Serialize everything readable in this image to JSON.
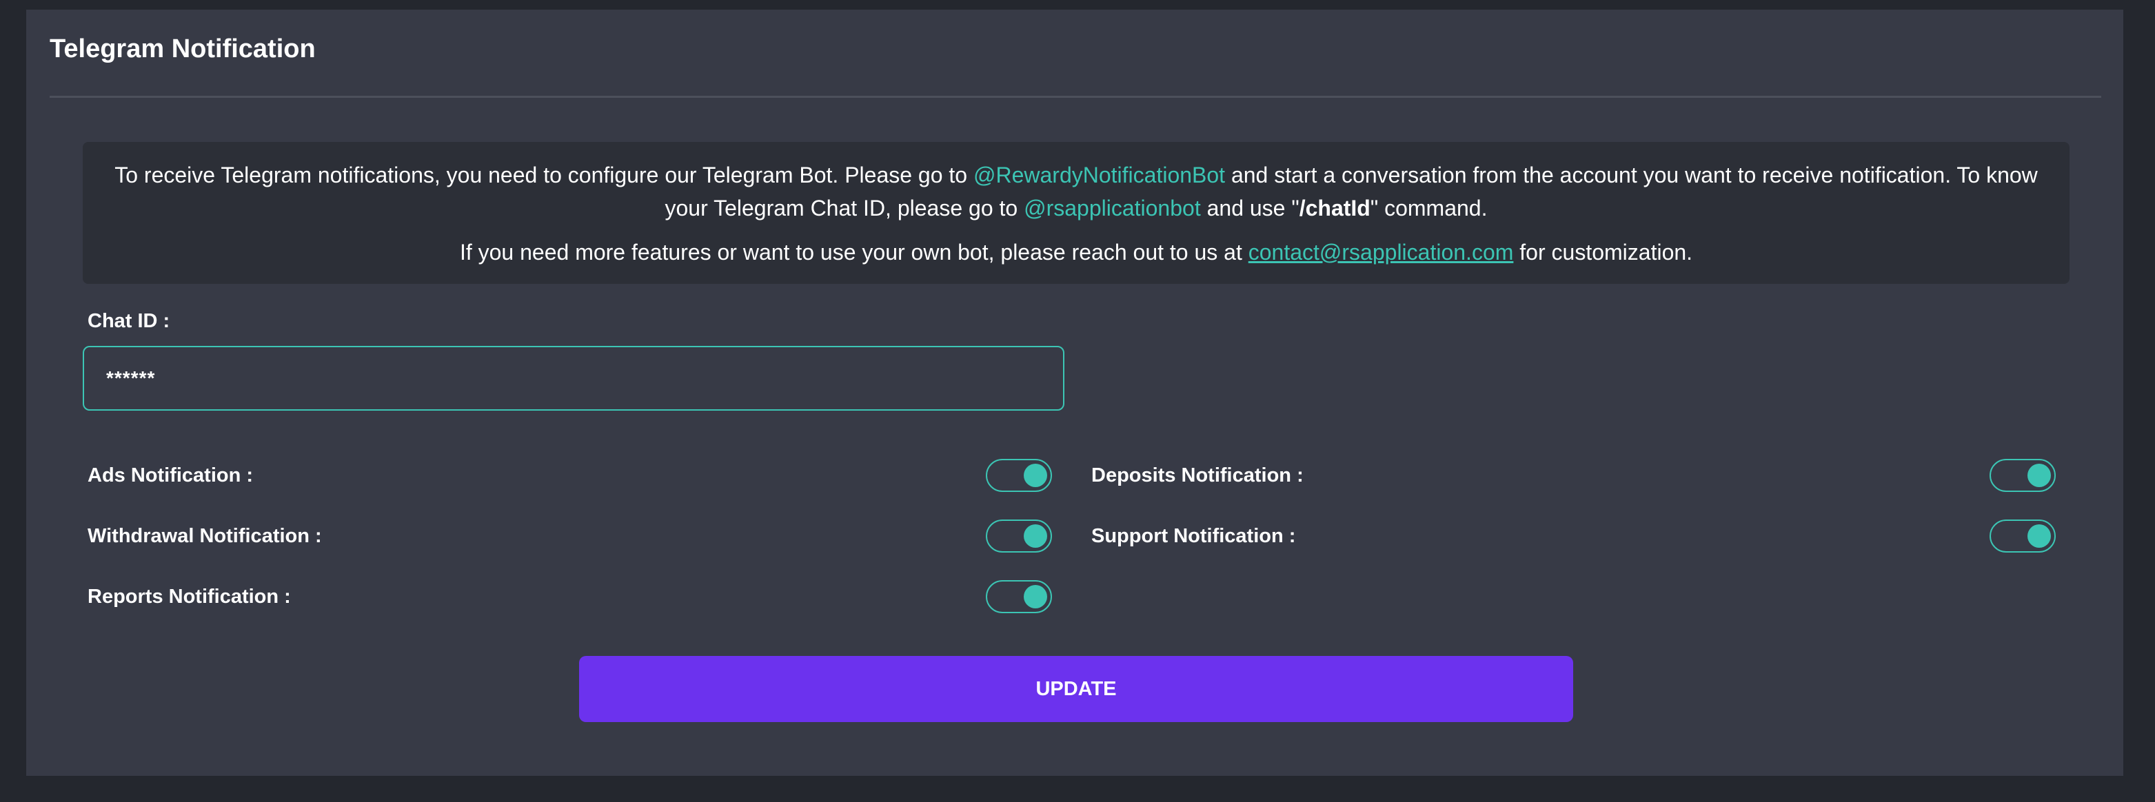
{
  "card": {
    "title": "Telegram Notification"
  },
  "info": {
    "line1_part1": "To receive Telegram notifications, you need to configure our Telegram Bot. Please go to ",
    "bot_link": "@RewardyNotificationBot",
    "line1_part2": " and start a conversation from the account you want to receive notification. To know your Telegram Chat ID, please go to ",
    "chatid_bot_link": "@rsapplicationbot",
    "line1_part3": " and use \"",
    "command": "/chatId",
    "line1_part4": "\" command.",
    "line2_part1": "If you need more features or want to use your own bot, please reach out to us at ",
    "contact_email": "contact@rsapplication.com",
    "line2_part2": " for customization."
  },
  "form": {
    "chat_id_label": "Chat ID :",
    "chat_id_value": "******",
    "toggles": {
      "ads": {
        "label": "Ads Notification :",
        "enabled": true
      },
      "deposits": {
        "label": "Deposits Notification :",
        "enabled": true
      },
      "withdrawal": {
        "label": "Withdrawal Notification :",
        "enabled": true
      },
      "support": {
        "label": "Support Notification :",
        "enabled": true
      },
      "reports": {
        "label": "Reports Notification :",
        "enabled": true
      }
    },
    "update_label": "UPDATE"
  },
  "colors": {
    "accent": "#3cc5b4",
    "button": "#6c32ee",
    "card_bg": "#373a46",
    "page_bg": "#24272e",
    "info_bg": "#2c2f37"
  }
}
